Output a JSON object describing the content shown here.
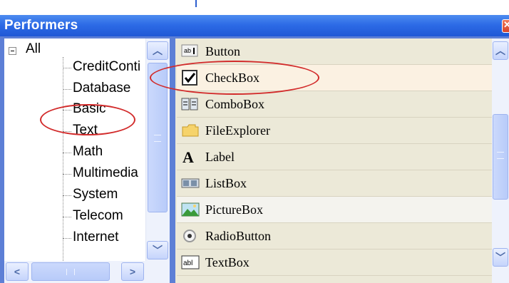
{
  "window": {
    "title": "Performers"
  },
  "tree": {
    "root_label": "All",
    "items": [
      {
        "label": "CreditConti"
      },
      {
        "label": "Database"
      },
      {
        "label": "Basic"
      },
      {
        "label": "Text"
      },
      {
        "label": "Math"
      },
      {
        "label": "Multimedia"
      },
      {
        "label": "System"
      },
      {
        "label": "Telecom"
      },
      {
        "label": "Internet"
      }
    ]
  },
  "list": {
    "items": [
      {
        "label": "Button",
        "icon": "button-icon"
      },
      {
        "label": "CheckBox",
        "icon": "checkbox-icon"
      },
      {
        "label": "ComboBox",
        "icon": "combobox-icon"
      },
      {
        "label": "FileExplorer",
        "icon": "folder-icon"
      },
      {
        "label": "Label",
        "icon": "label-icon"
      },
      {
        "label": "ListBox",
        "icon": "listbox-icon"
      },
      {
        "label": "PictureBox",
        "icon": "picture-icon"
      },
      {
        "label": "RadioButton",
        "icon": "radio-icon"
      },
      {
        "label": "TextBox",
        "icon": "textbox-icon"
      }
    ]
  },
  "colors": {
    "titlebar": "#2d6be6",
    "annotation": "#d22b2b",
    "selected_row": "#fbf1e2"
  }
}
